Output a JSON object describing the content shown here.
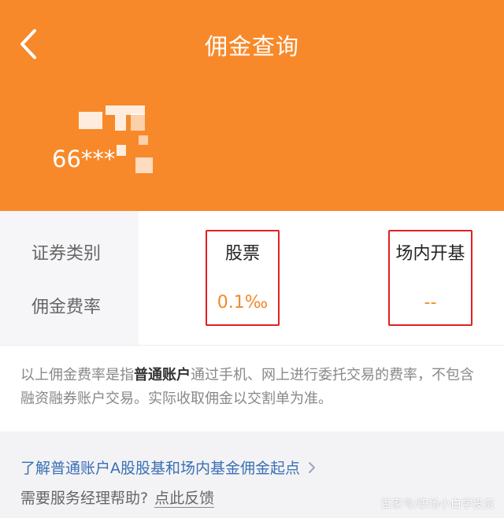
{
  "header": {
    "title": "佣金查询",
    "account_prefix": "66***",
    "bg_color": "#f7892a"
  },
  "table": {
    "row_labels": [
      "证券类别",
      "佣金费率"
    ],
    "columns": [
      {
        "category": "股票",
        "rate": "0.1‰"
      },
      {
        "category": "场内开基",
        "rate": "--"
      }
    ]
  },
  "note": {
    "before": "以上佣金费率是指",
    "bold": "普通账户",
    "after": "通过手机、网上进行委托交易的费率，不包含融资融券账户交易。实际收取佣金以交割单为准。"
  },
  "footer": {
    "learn_link": "了解普通账户A股股基和场内基金佣金起点",
    "help_prefix": "需要服务经理帮助?",
    "feedback_link": "点此反馈",
    "watermark": "百家号/职场小白学投资"
  },
  "icons": [
    "chevron-left-icon",
    "chevron-right-icon"
  ],
  "colors": {
    "accent": "#f7892a",
    "link": "#3a6fb5",
    "highlight_box": "#e02020"
  }
}
